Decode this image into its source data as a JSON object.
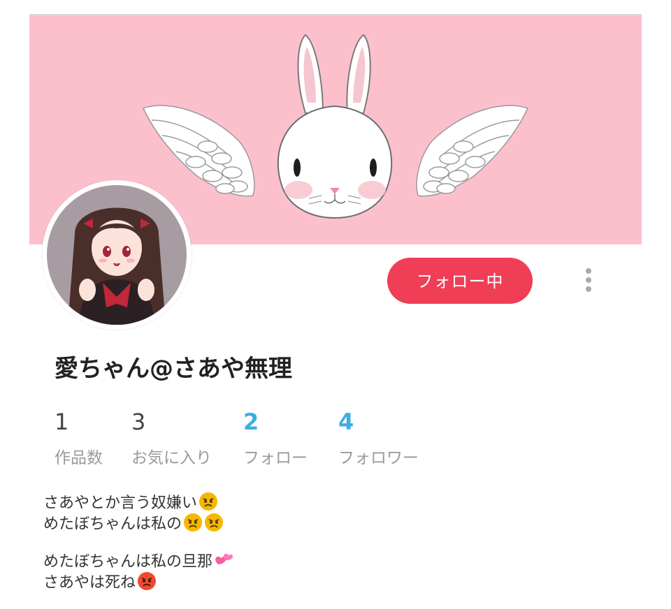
{
  "profile": {
    "display_name": "愛ちゃん@さあや無理",
    "follow_button_label": "フォロー中",
    "more_icon": "vertical-ellipsis-icon"
  },
  "stats": [
    {
      "count": "1",
      "label": "作品数",
      "link": false
    },
    {
      "count": "3",
      "label": "お気に入り",
      "link": false
    },
    {
      "count": "2",
      "label": "フォロー",
      "link": true
    },
    {
      "count": "4",
      "label": "フォロワー",
      "link": true
    }
  ],
  "bio": {
    "line1": "さあやとか言う奴嫌い",
    "line2": "めたぼちゃんは私の",
    "line3": "めたぼちゃんは私の旦那",
    "line4": "さあやは死ね",
    "icons": [
      "angry-face-icon",
      "angry-face-icon",
      "angry-face-icon",
      "two-hearts-icon",
      "pouting-face-icon"
    ]
  },
  "colors": {
    "banner": "#fcc0cd",
    "follow_button": "#ef3e55",
    "link_count": "#3aaee7",
    "label_gray": "#9a9a9a"
  }
}
